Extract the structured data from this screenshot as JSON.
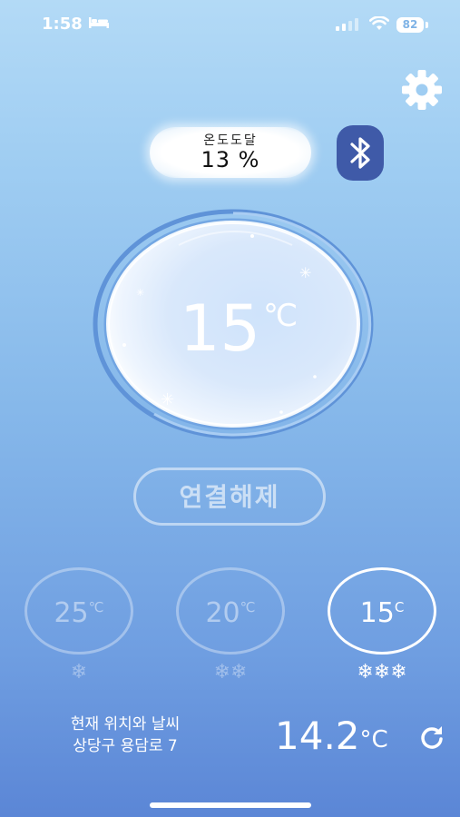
{
  "status_bar": {
    "time": "1:58",
    "battery": "82",
    "icons": [
      "bed-icon",
      "signal-icon",
      "wifi-icon",
      "battery-icon"
    ]
  },
  "header": {
    "settings_icon": "gear-icon",
    "arrival_label": "온도도달",
    "arrival_value": "13 %",
    "bluetooth_icon": "bluetooth-icon"
  },
  "gauge": {
    "temperature": "15",
    "unit": "℃"
  },
  "disconnect_label": "연결해제",
  "presets": [
    {
      "value": "25",
      "unit": "℃",
      "snow": "❄",
      "active": false
    },
    {
      "value": "20",
      "unit": "℃",
      "snow": "❄❄",
      "active": false
    },
    {
      "value": "15",
      "unit": "C",
      "snow": "❄❄❄",
      "active": true
    }
  ],
  "weather": {
    "title": "현재 위치와 날씨",
    "address": "상당구 용담로 7",
    "temperature": "14.2",
    "unit": "°C",
    "refresh_icon": "refresh-icon"
  },
  "colors": {
    "bluetooth_bg": "#3f5aa8",
    "bg_top": "#b3daf6",
    "bg_bottom": "#5b86d6"
  }
}
